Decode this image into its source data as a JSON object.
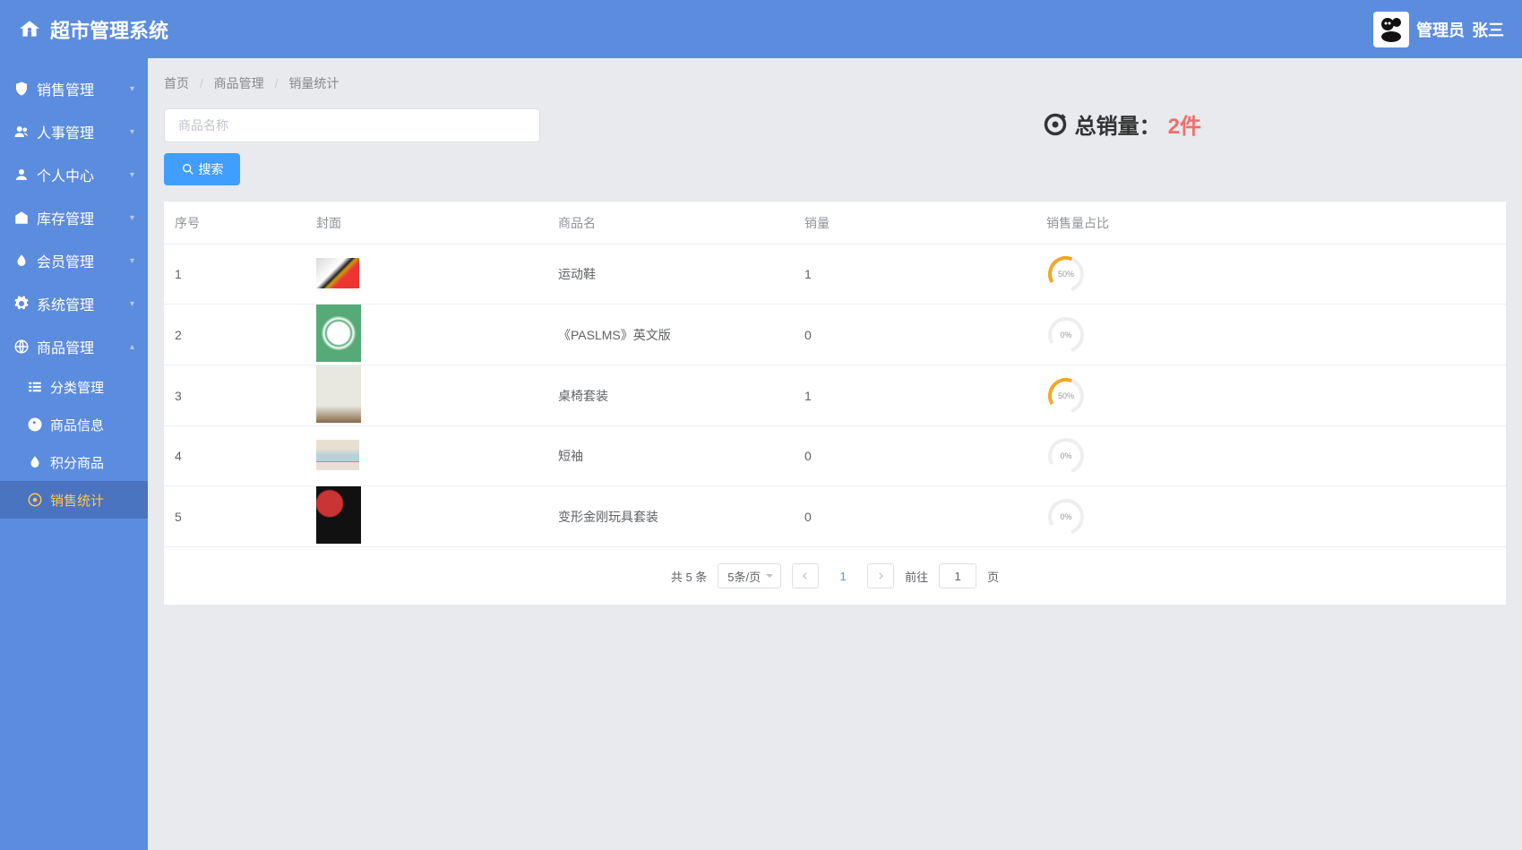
{
  "header": {
    "title": "超市管理系统",
    "user_role": "管理员",
    "user_name": "张三"
  },
  "sidebar": {
    "items": [
      {
        "label": "销售管理",
        "expanded": false
      },
      {
        "label": "人事管理",
        "expanded": false
      },
      {
        "label": "个人中心",
        "expanded": false
      },
      {
        "label": "库存管理",
        "expanded": false
      },
      {
        "label": "会员管理",
        "expanded": false
      },
      {
        "label": "系统管理",
        "expanded": false
      },
      {
        "label": "商品管理",
        "expanded": true
      }
    ],
    "subitems": [
      {
        "label": "分类管理"
      },
      {
        "label": "商品信息"
      },
      {
        "label": "积分商品"
      },
      {
        "label": "销售统计",
        "active": true
      }
    ]
  },
  "breadcrumb": {
    "b0": "首页",
    "b1": "商品管理",
    "b2": "销量统计"
  },
  "search": {
    "placeholder": "商品名称",
    "button": "搜索"
  },
  "total": {
    "label": "总销量：",
    "value": "2件"
  },
  "table": {
    "headers": {
      "idx": "序号",
      "cover": "封面",
      "name": "商品名",
      "sales": "销量",
      "ratio": "销售量占比"
    },
    "rows": [
      {
        "idx": "1",
        "name": "运动鞋",
        "sales": "1",
        "ratio": 50,
        "thumb": "t1",
        "tall": false
      },
      {
        "idx": "2",
        "name": "《PASLMS》英文版",
        "sales": "0",
        "ratio": 0,
        "thumb": "t2",
        "tall": true
      },
      {
        "idx": "3",
        "name": "桌椅套装",
        "sales": "1",
        "ratio": 50,
        "thumb": "t3",
        "tall": true
      },
      {
        "idx": "4",
        "name": "短袖",
        "sales": "0",
        "ratio": 0,
        "thumb": "t4",
        "tall": false
      },
      {
        "idx": "5",
        "name": "变形金刚玩具套装",
        "sales": "0",
        "ratio": 0,
        "thumb": "t5",
        "tall": true
      }
    ]
  },
  "pagination": {
    "total": "共 5 条",
    "per_page": "5条/页",
    "current": "1",
    "goto_label_pre": "前往",
    "goto_label_post": "页",
    "goto_value": "1"
  }
}
